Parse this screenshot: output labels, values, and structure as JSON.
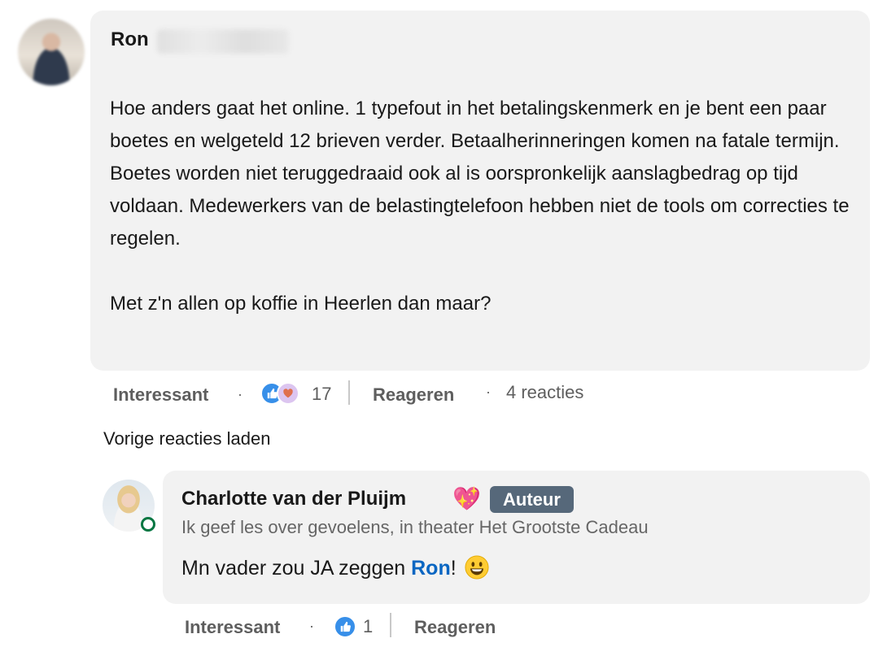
{
  "comment": {
    "author_first": "Ron",
    "body": "Hoe anders gaat het online. 1 typefout in het betalingskenmerk en je bent een paar boetes en welgeteld 12 brieven verder. Betaalherinneringen komen na fatale termijn. Boetes worden niet teruggedraaid ook al is oorspronkelijk aanslagbedrag op tijd voldaan. Medewerkers van de belastingtelefoon hebben niet de tools om correcties te regelen.\n\nMet z'n allen op koffie in Heerlen dan maar?",
    "actions": {
      "react_label": "Interessant",
      "reaction_count": "17",
      "reply_label": "Reageren",
      "replies_count": "4 reacties"
    }
  },
  "load_more": "Vorige reacties laden",
  "reply": {
    "author": "Charlotte van der Pluijm",
    "author_emoji": "💖",
    "badge": "Auteur",
    "headline": "Ik geef les over gevoelens, in theater Het Grootste Cadeau",
    "text_before": "Mn vader zou JA zeggen ",
    "mention": "Ron",
    "text_after": "!",
    "actions": {
      "react_label": "Interessant",
      "reaction_count": "1",
      "reply_label": "Reageren"
    }
  },
  "colors": {
    "bubble": "#f2f2f2",
    "mention": "#0a66c2",
    "badge": "#56687a",
    "online": "#057642",
    "like": "#378fe9"
  },
  "icons": [
    "like-reaction-icon",
    "love-reaction-icon",
    "smiley-emoji-icon",
    "sparkle-heart-emoji-icon",
    "online-status-icon"
  ]
}
